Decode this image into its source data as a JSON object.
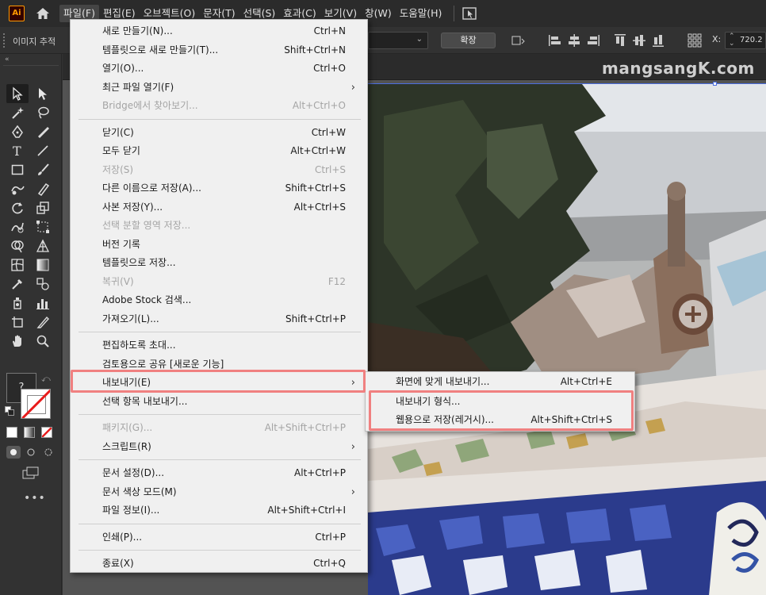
{
  "menubar": {
    "app_logo": "Ai",
    "items": [
      "파일(F)",
      "편집(E)",
      "오브젝트(O)",
      "문자(T)",
      "선택(S)",
      "효과(C)",
      "보기(V)",
      "창(W)",
      "도움말(H)"
    ],
    "active_item": "파일(F)"
  },
  "controlbar": {
    "label": "이미지 추적",
    "expand_button": "확장",
    "x_label": "X:",
    "x_value": "720.2"
  },
  "document": {
    "watermark": "mangsangK.com"
  },
  "file_menu": {
    "groups": [
      [
        {
          "label": "새로 만들기(N)...",
          "shortcut": "Ctrl+N"
        },
        {
          "label": "템플릿으로 새로 만들기(T)...",
          "shortcut": "Shift+Ctrl+N"
        },
        {
          "label": "열기(O)...",
          "shortcut": "Ctrl+O"
        },
        {
          "label": "최근 파일 열기(F)",
          "submenu": true
        },
        {
          "label": "Bridge에서 찾아보기...",
          "shortcut": "Alt+Ctrl+O",
          "disabled": true
        }
      ],
      [
        {
          "label": "닫기(C)",
          "shortcut": "Ctrl+W"
        },
        {
          "label": "모두 닫기",
          "shortcut": "Alt+Ctrl+W"
        },
        {
          "label": "저장(S)",
          "shortcut": "Ctrl+S",
          "disabled": true
        },
        {
          "label": "다른 이름으로 저장(A)...",
          "shortcut": "Shift+Ctrl+S"
        },
        {
          "label": "사본 저장(Y)...",
          "shortcut": "Alt+Ctrl+S"
        },
        {
          "label": "선택 분할 영역 저장...",
          "disabled": true
        },
        {
          "label": "버전 기록"
        },
        {
          "label": "템플릿으로 저장..."
        },
        {
          "label": "복귀(V)",
          "shortcut": "F12",
          "disabled": true
        },
        {
          "label": "Adobe Stock 검색..."
        },
        {
          "label": "가져오기(L)...",
          "shortcut": "Shift+Ctrl+P"
        }
      ],
      [
        {
          "label": "편집하도록 초대..."
        },
        {
          "label": "검토용으로 공유 [새로운 기능]"
        },
        {
          "label": "내보내기(E)",
          "submenu": true,
          "highlighted": true
        },
        {
          "label": "선택 항목 내보내기..."
        }
      ],
      [
        {
          "label": "패키지(G)...",
          "shortcut": "Alt+Shift+Ctrl+P",
          "disabled": true
        },
        {
          "label": "스크립트(R)",
          "submenu": true
        }
      ],
      [
        {
          "label": "문서 설정(D)...",
          "shortcut": "Alt+Ctrl+P"
        },
        {
          "label": "문서 색상 모드(M)",
          "submenu": true
        },
        {
          "label": "파일 정보(I)...",
          "shortcut": "Alt+Shift+Ctrl+I"
        }
      ],
      [
        {
          "label": "인쇄(P)...",
          "shortcut": "Ctrl+P"
        }
      ],
      [
        {
          "label": "종료(X)",
          "shortcut": "Ctrl+Q"
        }
      ]
    ]
  },
  "export_submenu": {
    "items": [
      {
        "label": "화면에 맞게 내보내기...",
        "shortcut": "Alt+Ctrl+E"
      },
      {
        "label": "내보내기 형식..."
      },
      {
        "label": "웹용으로 저장(레거시)...",
        "shortcut": "Alt+Shift+Ctrl+S"
      }
    ]
  },
  "colors": {
    "highlight_box": "#f08080",
    "menu_bg": "#f0f0f0",
    "ui_dark": "#323232"
  }
}
